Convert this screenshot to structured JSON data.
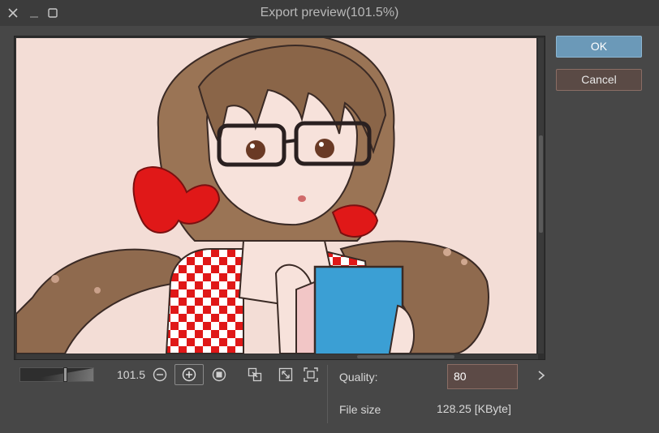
{
  "window": {
    "title": "Export preview(101.5%)",
    "controls": [
      "close-icon",
      "minimize-icon",
      "maximize-icon"
    ]
  },
  "buttons": {
    "ok": "OK",
    "cancel": "Cancel"
  },
  "zoom": {
    "value": "101.5",
    "slider_fraction": 0.62,
    "tools": [
      "zoom-out-icon",
      "zoom-in-icon",
      "zoom-100-icon",
      "fit-window-icon",
      "fit-diagonal-icon",
      "fit-screen-icon"
    ]
  },
  "settings": {
    "quality_label": "Quality:",
    "quality_value": "80",
    "file_size_label": "File size",
    "file_size_value": "128.25 [KByte]"
  },
  "colors": {
    "accent_ok": "#6b99b8",
    "cancel_bg": "#5a4a45",
    "preview_bg": "#f3ddd6",
    "dialog_bg": "#474747"
  }
}
